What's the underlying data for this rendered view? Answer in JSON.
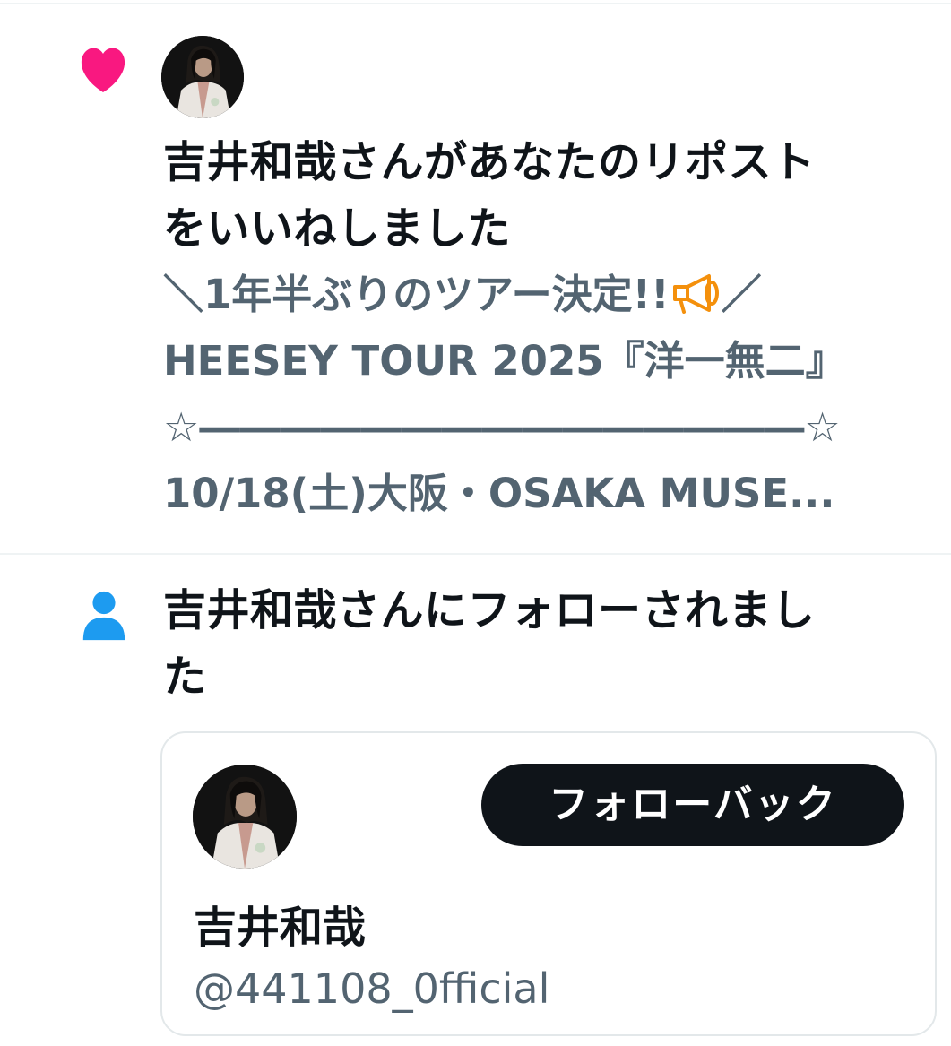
{
  "notifications": {
    "like": {
      "icon": "heart-icon",
      "icon_color": "#f91880",
      "headline": "吉井和哉さんがあなたのリポストをいいねしました",
      "headline_line1": "吉井和哉さんがあなたのリポスト",
      "headline_line2": "をいいねしました",
      "preview_lines": {
        "line1_before": "＼1年半ぶりのツアー決定!!",
        "line1_after": "／",
        "line2": "HEESEY TOUR 2025『洋一無二』",
        "line3": "☆―――――――――――――――☆",
        "line4": "10/18(土)大阪・OSAKA MUSE..."
      },
      "preview_emoji": "megaphone-icon"
    },
    "follow": {
      "icon": "person-icon",
      "icon_color": "#1d9bf0",
      "headline_line1": "吉井和哉さんにフォローされまし",
      "headline_line2": "た",
      "user_card": {
        "button_label": "フォローバック",
        "name": "吉井和哉",
        "handle": "@441108_0fficial"
      }
    }
  },
  "colors": {
    "primary_text": "#0f1419",
    "secondary_text": "#536471",
    "like_pink": "#f91880",
    "follow_blue": "#1d9bf0",
    "divider": "#eff3f4"
  }
}
